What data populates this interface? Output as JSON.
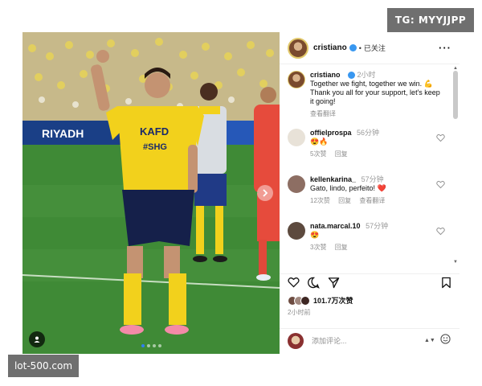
{
  "watermarks": {
    "top": "TG: MYYJJPP",
    "bottom": "lot-500.com"
  },
  "post": {
    "author": "cristiano",
    "separator": "•",
    "follow_status": "已关注",
    "more": "···",
    "caption": {
      "user": "cristiano",
      "time": "2小时",
      "text": "Together we fight, together we win. 💪 Thank you all for your support, let's keep it going!",
      "translate": "查看翻译"
    },
    "comments": [
      {
        "user": "offielprospa",
        "time": "56分钟",
        "text": "😍🔥",
        "likes": "5次赞",
        "reply": "回复",
        "translate": ""
      },
      {
        "user": "kellenkarina_",
        "time": "57分钟",
        "text": "Gato, lindo, perfeito! ❤️",
        "likes": "12次赞",
        "reply": "回复",
        "translate": "查看翻译"
      },
      {
        "user": "nata.marcal.10",
        "time": "57分钟",
        "text": "😍",
        "likes": "3次赞",
        "reply": "回复",
        "translate": ""
      }
    ],
    "likes_count": "101.7万次赞",
    "posted_ago": "2小时前",
    "comment_placeholder": "添加评论...",
    "shirt_lines": [
      "KAFD",
      "#SHG"
    ],
    "board_text": "RIYADH",
    "icons": {
      "like": "heart-icon",
      "comment": "comment-icon",
      "share": "share-icon",
      "save": "bookmark-icon",
      "emoji": "emoji-icon",
      "next": "chevron-right-icon",
      "tag": "user-tag-icon",
      "more": "more-icon"
    },
    "colors": {
      "accent": "#3897f0",
      "like_red": "#ed4956",
      "jersey": "#f2d11c",
      "kit_navy": "#15204a"
    }
  }
}
